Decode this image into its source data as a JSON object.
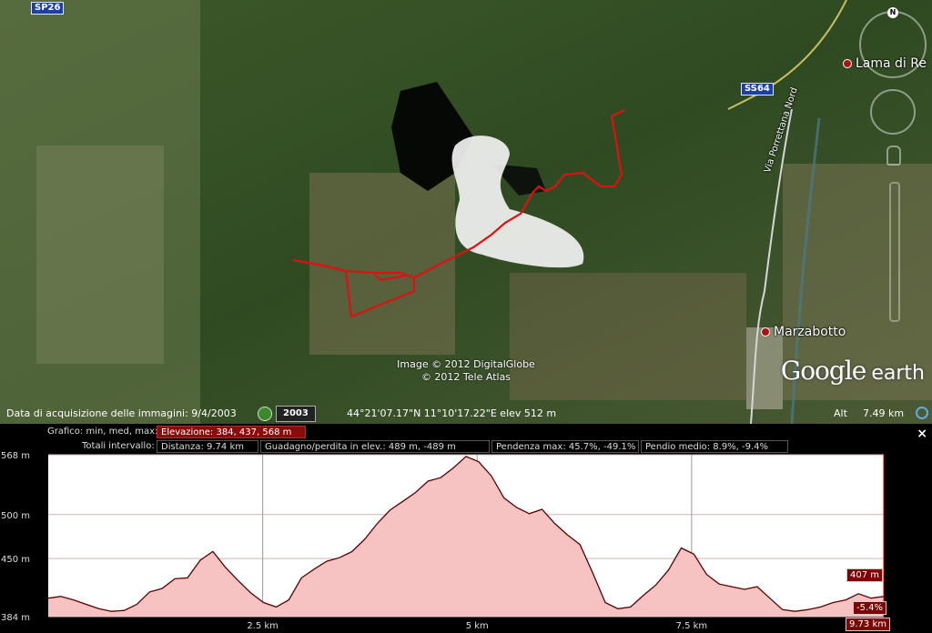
{
  "map": {
    "road_labels": [
      "SP26",
      "SS64"
    ],
    "street_label": "Via Porrettana Nord",
    "places": [
      "Lama di Re",
      "Marzabotto"
    ],
    "copyright_lines": [
      "Image © 2012 DigitalGlobe",
      "© 2012 Tele Atlas"
    ],
    "logo": "Google earth",
    "compass_label": "N",
    "colors": {
      "track": "#e01010",
      "shield": "#1b3fa3"
    }
  },
  "status": {
    "acquisition": "Data di acquisizione delle immagini: 9/4/2003",
    "year": "2003",
    "coordinates": "44°21'07.17\"N  11°10'17.22\"E  elev  512 m",
    "altitude_label": "Alt",
    "altitude_value": "7.49 km"
  },
  "profile": {
    "chart_label": "Grafico: min, med, max:",
    "elevation_field": "Elevazione: 384, 437, 568 m",
    "totals_label": "Totali intervallo:",
    "distance_field": "Distanza: 9.74 km",
    "gain_field": "Guadagno/perdita in elev.: 489 m, -489 m",
    "slope_max_field": "Pendenza max: 45.7%, -49.1%",
    "slope_avg_field": "Pendio medio: 8.9%, -9.4%",
    "close_label": "×",
    "cursor_elevation": "407 m",
    "cursor_slope": "-5.4%",
    "cursor_distance": "9.73 km"
  },
  "chart_data": {
    "type": "area",
    "xlabel": "",
    "ylabel": "",
    "ylim": [
      384,
      568
    ],
    "xlim": [
      0,
      9.74
    ],
    "y_tick_labels": [
      "568 m",
      "500 m",
      "450 m",
      "384 m"
    ],
    "y_ticks": [
      568,
      500,
      450,
      384
    ],
    "x_tick_labels": [
      "2.5 km",
      "5 km",
      "7.5 km"
    ],
    "x_ticks": [
      2.5,
      5,
      7.5
    ],
    "fill_color": "#f7c2c2",
    "line_color": "#5a0000",
    "x": [
      0,
      0.2,
      0.4,
      0.6,
      0.8,
      1.0,
      1.2,
      1.4,
      1.6,
      1.8,
      2.0,
      2.2,
      2.4,
      2.6,
      2.8,
      3.0,
      3.2,
      3.4,
      3.6,
      3.8,
      4.0,
      4.2,
      4.4,
      4.6,
      4.8,
      5.0,
      5.2,
      5.4,
      5.6,
      5.8,
      6.0,
      6.2,
      6.4,
      6.6,
      6.8,
      7.0,
      7.2,
      7.4,
      7.6,
      7.8,
      8.0,
      8.2,
      8.4,
      8.6,
      8.8,
      9.0,
      9.2,
      9.4,
      9.6,
      9.74
    ],
    "y": [
      405,
      407,
      403,
      398,
      393,
      390,
      391,
      398,
      412,
      416,
      427,
      428,
      448,
      458,
      440,
      425,
      411,
      400,
      395,
      403,
      428,
      438,
      447,
      451,
      458,
      472,
      490,
      505,
      515,
      525,
      538,
      542,
      553,
      566,
      560,
      544,
      519,
      508,
      501,
      506,
      490,
      477,
      466,
      434,
      400,
      393,
      395,
      408,
      420,
      437,
      462,
      455,
      432,
      421,
      418,
      415,
      418,
      405,
      392,
      390,
      392,
      395,
      400,
      403,
      410,
      405,
      407
    ]
  }
}
